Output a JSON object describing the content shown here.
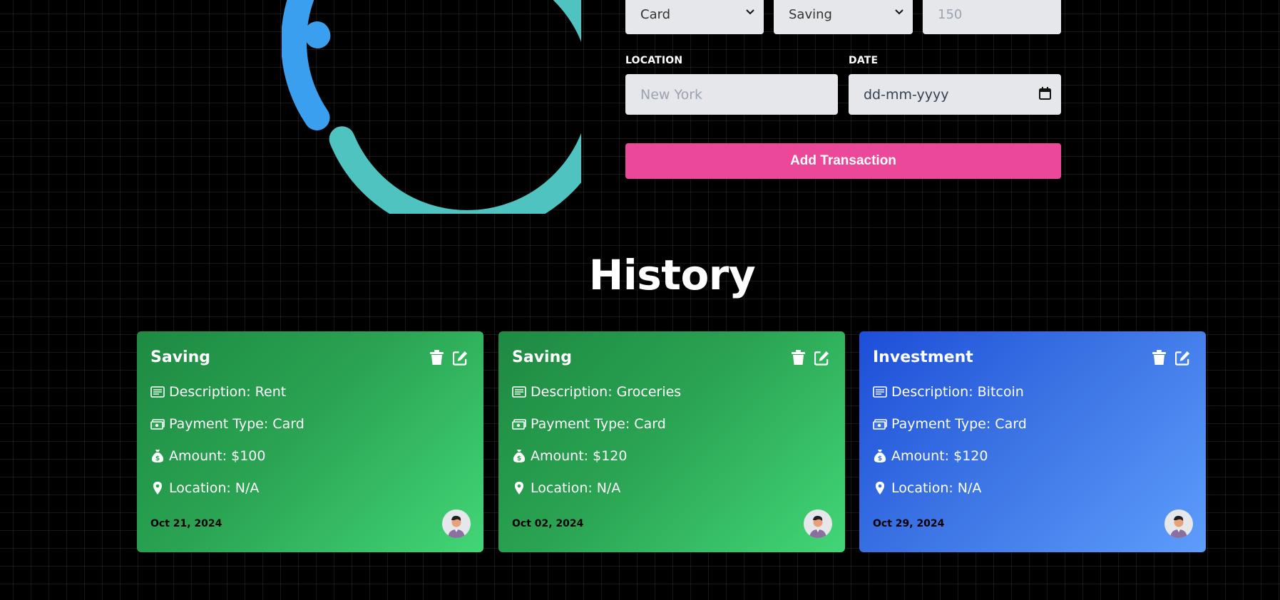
{
  "form": {
    "payment_type_value": "Card",
    "category_value": "Saving",
    "amount_placeholder": "150",
    "location_label": "LOCATION",
    "location_placeholder": "New York",
    "date_label": "DATE",
    "date_placeholder": "dd-mm-yyyy",
    "submit_label": "Add Transaction"
  },
  "chart": {
    "colors": [
      "#3b9ff0",
      "#4fc3c0"
    ]
  },
  "history": {
    "title": "History",
    "cards": [
      {
        "category": "Saving",
        "description": "Description: Rent",
        "payment": "Payment Type: Card",
        "amount": "Amount: $100",
        "location": "Location: N/A",
        "date": "Oct 21, 2024",
        "color": "green"
      },
      {
        "category": "Saving",
        "description": "Description: Groceries",
        "payment": "Payment Type: Card",
        "amount": "Amount: $120",
        "location": "Location: N/A",
        "date": "Oct 02, 2024",
        "color": "green"
      },
      {
        "category": "Investment",
        "description": "Description: Bitcoin",
        "payment": "Payment Type: Card",
        "amount": "Amount: $120",
        "location": "Location: N/A",
        "date": "Oct 29, 2024",
        "color": "blue"
      }
    ]
  }
}
